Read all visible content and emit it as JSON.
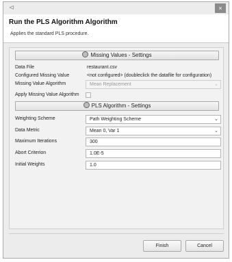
{
  "window": {
    "title": "Run the PLS Algorithm Algorithm",
    "description": "Applies the standard PLS procedure.",
    "close_glyph": "×",
    "app_icon": "⊲"
  },
  "missing_values_section": {
    "header_label": "Missing Values - Settings",
    "data_file_label": "Data File",
    "data_file_value": "restaurant.csv",
    "configured_missing_label": "Configured Missing Value",
    "configured_missing_value": "<not configured> (doubleclick the datafile for configuration)",
    "algorithm_label": "Missing Value Algorithm",
    "algorithm_value": "Mean Replacement",
    "apply_label": "Apply Missing Value Algorithm",
    "apply_checked": false
  },
  "pls_section": {
    "header_label": "PLS Algorithm - Settings",
    "weighting_label": "Weighting Scheme",
    "weighting_value": "Path Weighting Scheme",
    "metric_label": "Data Metric",
    "metric_value": "Mean 0, Var 1",
    "max_iter_label": "Maximum Iterations",
    "max_iter_value": "300",
    "abort_label": "Abort Criterion",
    "abort_value": "1.0E-5",
    "init_weights_label": "Initial Weights",
    "init_weights_value": "1.0"
  },
  "buttons": {
    "finish": "Finish",
    "cancel": "Cancel"
  },
  "icons": {
    "dropdown": "⌄"
  }
}
